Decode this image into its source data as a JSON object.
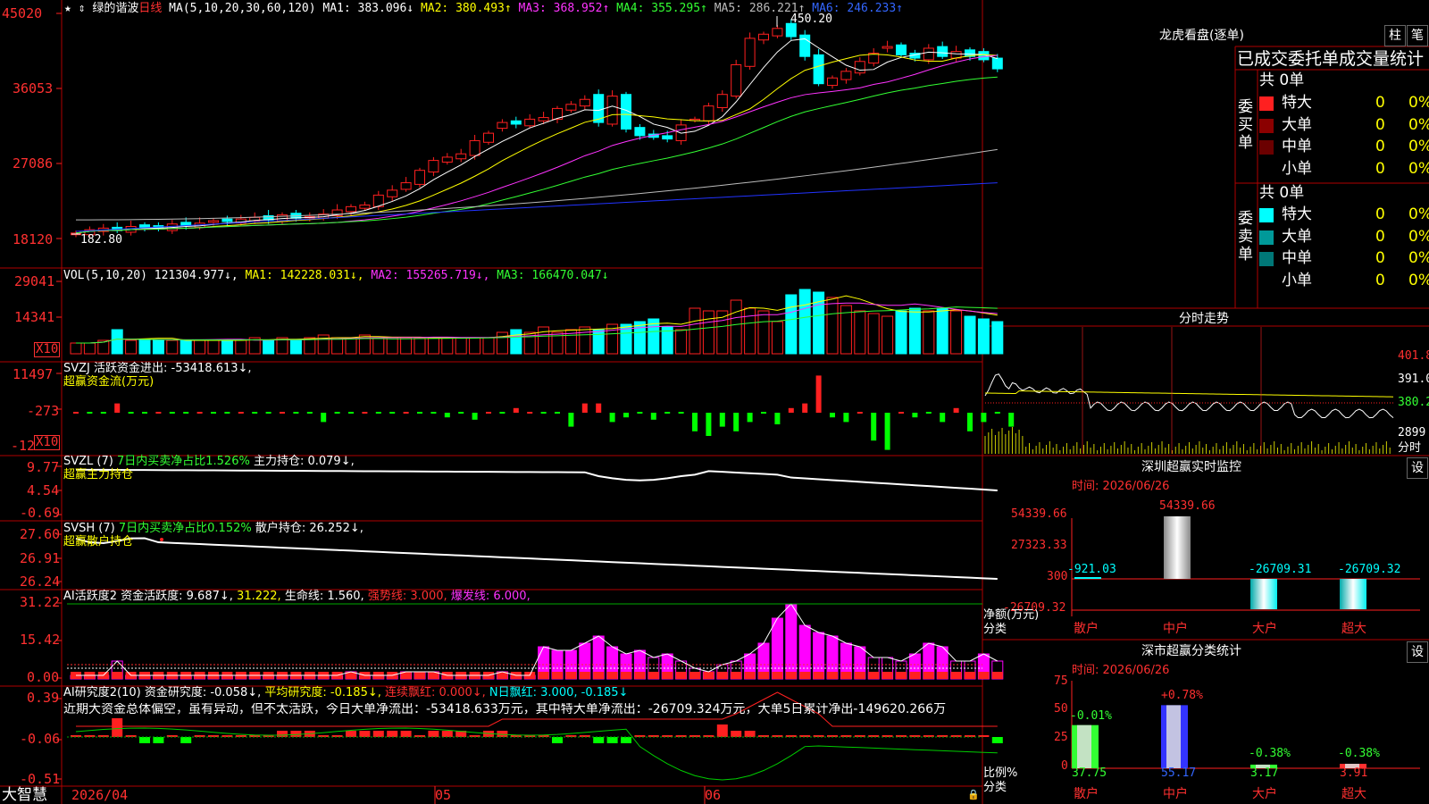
{
  "colors": {
    "up": "#ff2020",
    "down": "#00ffff",
    "border": "#b00000",
    "ma1": "#ffffff",
    "ma2": "#ffff00",
    "ma3": "#ff33ff",
    "ma4": "#33ff33",
    "ma5": "#bbbbbb",
    "ma6": "#2233ff"
  },
  "header": {
    "star": "★ ⇕",
    "stock_name": "绿的谐波",
    "period": "日线",
    "ma_params": "MA(5,10,20,30,60,120)",
    "ma1": "MA1: 383.096↓",
    "ma2": "MA2: 380.493↑",
    "ma3": "MA3: 368.952↑",
    "ma4": "MA4: 355.295↑",
    "ma5": "MA5: 286.221↑",
    "ma6": "MA6: 246.233↑",
    "cursor_mark": "⇕"
  },
  "price_axis": [
    "45020",
    "36053",
    "27086",
    "18120"
  ],
  "price_marks": {
    "high": "450.20",
    "low": "182.80"
  },
  "vol": {
    "label": "VOL(5,10,20)",
    "value": "121304.977↓,",
    "ma1": "MA1: 142228.031↓,",
    "ma2": "MA2: 155265.719↓,",
    "ma3": "MA3: 166470.047↓",
    "axis": [
      "29041",
      "14341"
    ],
    "unit": "X10"
  },
  "svzj": {
    "label": "SVZJ 活跃资金进出: -53418.613↓,",
    "sub": "超赢资金流(万元)",
    "axis": [
      "11497",
      "-273",
      "-12"
    ],
    "unit": "X10"
  },
  "svzl": {
    "label": "SVZL (7)",
    "ratio": "7日内买卖净占比1.526%",
    "hold": "主力持仓: 0.079↓,",
    "sub": "超赢主力持仓",
    "axis": [
      "9.77",
      "4.54",
      "-0.69"
    ]
  },
  "svsh": {
    "label": "SVSH (7)",
    "ratio": "7日内买卖净占比0.152%",
    "hold": "散户持仓: 26.252↓,",
    "sub": "超赢散户持仓",
    "axis": [
      "27.60",
      "26.91",
      "26.24"
    ]
  },
  "ai1": {
    "label": "AI活跃度2",
    "active": "资金活跃度: 9.687↓,",
    "v2": "31.222,",
    "life": "生命线: 1.560,",
    "strong": "强势线: 3.000,",
    "burst": "爆发线: 6.000,",
    "axis": [
      "31.22",
      "15.42",
      "0.00"
    ]
  },
  "ai2": {
    "label": "AI研究度2(10)",
    "research": "资金研究度: -0.058↓,",
    "avg": "平均研究度: -0.185↓,",
    "cont": "连续飘红: 0.000↓,",
    "nday": "N日飘红: 3.000, -0.185↓",
    "comment": "近期大资金总体偏空，虽有异动，但不太活跃，今日大单净流出：-53418.633万元，其中特大单净流出：-26709.324万元，大单5日累计净出-149620.266万",
    "axis": [
      "0.39",
      "-0.06",
      "-0.51"
    ]
  },
  "footer": {
    "brand": "大智慧",
    "date": "2026/04",
    "month1": "05",
    "month2": "06",
    "lock": "🔒"
  },
  "dragon": {
    "title": "龙虎看盘(逐单)",
    "btn1": "柱",
    "btn2": "笔",
    "tabs": "已成交委托单成交量统计",
    "buy_side": "委买单",
    "sell_side": "委卖单",
    "buy_total": "共 0单",
    "sell_total": "共 0单",
    "buy_rows": [
      {
        "label": "特大",
        "count": "0",
        "pct": "0%",
        "color": "#ff2020"
      },
      {
        "label": "大单",
        "count": "0",
        "pct": "0%",
        "color": "#8b0000"
      },
      {
        "label": "中单",
        "count": "0",
        "pct": "0%",
        "color": "#6b0000"
      },
      {
        "label": "小单",
        "count": "0",
        "pct": "0%",
        "color": "#000000"
      }
    ],
    "sell_rows": [
      {
        "label": "特大",
        "count": "0",
        "pct": "0%",
        "color": "#00ffff"
      },
      {
        "label": "大单",
        "count": "0",
        "pct": "0%",
        "color": "#009999"
      },
      {
        "label": "中单",
        "count": "0",
        "pct": "0%",
        "color": "#007777"
      },
      {
        "label": "小单",
        "count": "0",
        "pct": "0%",
        "color": "#000000"
      }
    ]
  },
  "intraday": {
    "title": "分时走势",
    "axis": [
      "401.8",
      "391.0",
      "380.2",
      "2899"
    ],
    "time_label": "分时"
  },
  "monitor": {
    "title": "深圳超赢实时监控",
    "btn": "设",
    "time": "时间: 2026/06/26",
    "axis": [
      "54339.66",
      "27323.33",
      "300",
      "-26709.32"
    ],
    "y_label": "净额(万元)",
    "x_label": "分类",
    "categories": [
      "散户",
      "中户",
      "大户",
      "超大"
    ],
    "values": [
      "-921.03",
      "54339.66",
      "-26709.31",
      "-26709.32"
    ]
  },
  "classify": {
    "title": "深市超赢分类统计",
    "btn": "设",
    "time": "时间: 2026/06/26",
    "axis": [
      "75",
      "50",
      "25",
      "0"
    ],
    "y_label": "比例%",
    "x_label": "分类",
    "categories": [
      "散户",
      "中户",
      "大户",
      "超大"
    ],
    "pct_changes": [
      "-0.01%",
      "+0.78%",
      "-0.38%",
      "-0.38%"
    ],
    "values": [
      "37.75",
      "55.17",
      "3.17",
      "3.91"
    ]
  }
}
